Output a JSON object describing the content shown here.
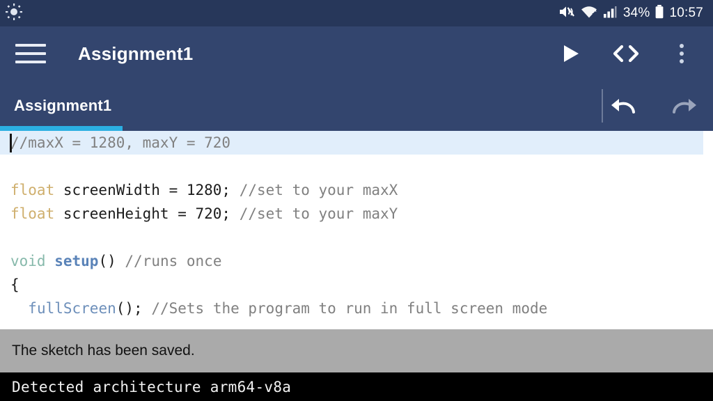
{
  "status_bar": {
    "brightness_icon": "brightness-sun-icon",
    "mute_icon": "volume-mute-icon",
    "wifi_icon": "wifi-icon",
    "signal_icon": "cellular-signal-icon",
    "battery_percent": "34%",
    "battery_icon": "battery-icon",
    "clock": "10:57",
    "bg_color": "#27375a"
  },
  "toolbar": {
    "menu_icon": "hamburger-menu-icon",
    "title": "Assignment1",
    "run_icon": "play-run-icon",
    "code_icon": "code-brackets-icon",
    "overflow_icon": "overflow-menu-icon",
    "bg_color": "#33456e"
  },
  "tab_bar": {
    "tabs": [
      {
        "label": "Assignment1",
        "active": true
      }
    ],
    "active_indicator_color": "#2bafe2",
    "undo_icon": "undo-arrow-icon",
    "redo_icon": "redo-arrow-icon",
    "undo_enabled": true,
    "redo_enabled": false
  },
  "editor": {
    "background": "#ffffff",
    "current_line_highlight": "#e1eefb",
    "cursor_line": 1,
    "lines": [
      {
        "segments": [
          {
            "text": "//maxX = 1280, maxY = 720",
            "token": "comment"
          }
        ],
        "current": true
      },
      {
        "segments": [
          {
            "text": "",
            "token": "plain"
          }
        ],
        "current": false
      },
      {
        "segments": [
          {
            "text": "float",
            "token": "type"
          },
          {
            "text": " screenWidth = 1280; ",
            "token": "plain"
          },
          {
            "text": "//set to your maxX",
            "token": "comment"
          }
        ],
        "current": false
      },
      {
        "segments": [
          {
            "text": "float",
            "token": "type"
          },
          {
            "text": " screenHeight = 720; ",
            "token": "plain"
          },
          {
            "text": "//set to your maxY",
            "token": "comment"
          }
        ],
        "current": false
      },
      {
        "segments": [
          {
            "text": "",
            "token": "plain"
          }
        ],
        "current": false
      },
      {
        "segments": [
          {
            "text": "void",
            "token": "void"
          },
          {
            "text": " ",
            "token": "plain"
          },
          {
            "text": "setup",
            "token": "fn-bold"
          },
          {
            "text": "() ",
            "token": "plain"
          },
          {
            "text": "//runs once",
            "token": "comment"
          }
        ],
        "current": false
      },
      {
        "segments": [
          {
            "text": "{",
            "token": "plain"
          }
        ],
        "current": false
      },
      {
        "segments": [
          {
            "text": "  ",
            "token": "plain"
          },
          {
            "text": "fullScreen",
            "token": "fn"
          },
          {
            "text": "(); ",
            "token": "plain"
          },
          {
            "text": "//Sets the program to run in full screen mode",
            "token": "comment"
          }
        ],
        "current": false
      },
      {
        "segments": [
          {
            "text": "",
            "token": "plain"
          }
        ],
        "current": false
      },
      {
        "segments": [
          {
            "text": "}",
            "token": "plain"
          }
        ],
        "current": false
      }
    ],
    "syntax_colors": {
      "comment": "#808080",
      "type": "#cfaf6d",
      "void": "#87b9ab",
      "fn_bold": "#5a83b8",
      "fn": "#6d8fba",
      "plain": "#1b1b1b"
    }
  },
  "message_bar": {
    "text": "The sketch has been saved.",
    "bg_color": "#aaaaaa"
  },
  "console": {
    "text": "Detected architecture arm64-v8a",
    "bg_color": "#000000",
    "text_color": "#f2f2f2"
  }
}
